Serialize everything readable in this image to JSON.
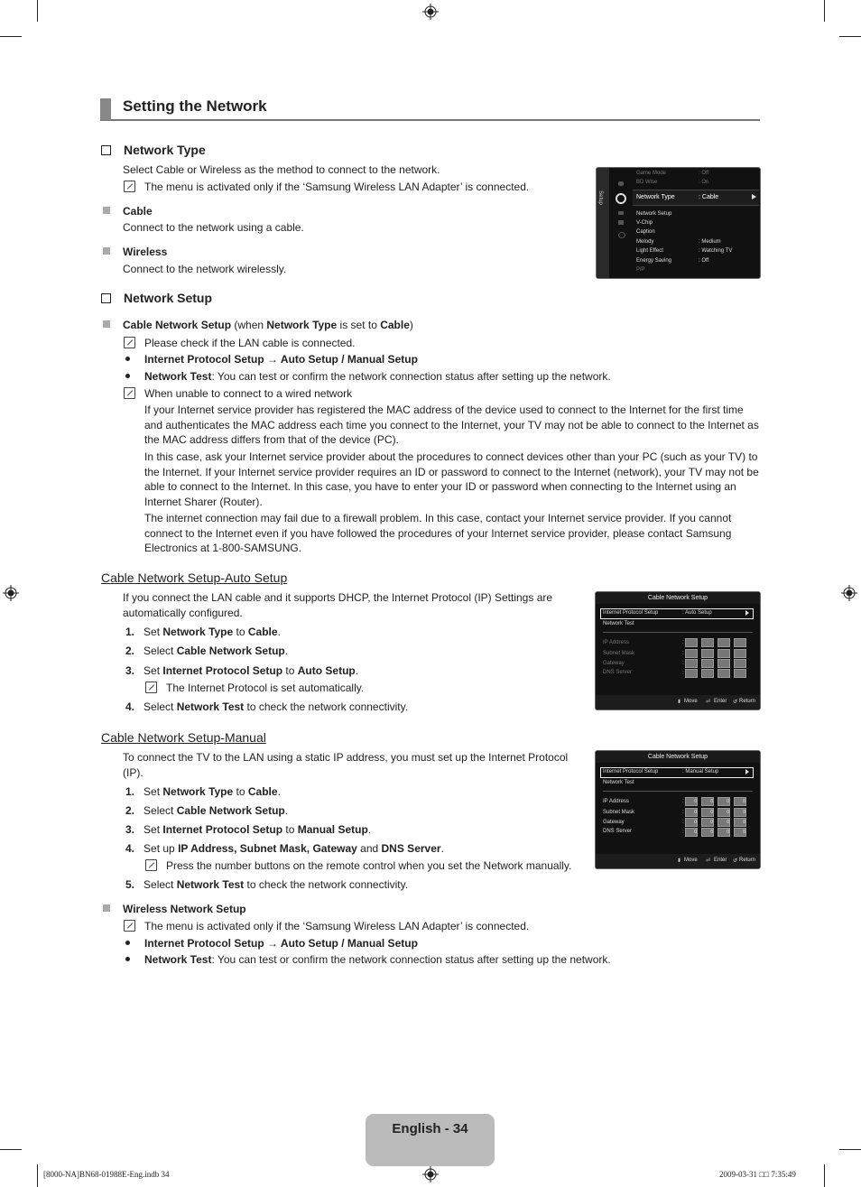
{
  "page": {
    "title": "Setting the Network",
    "page_label": "English - 34",
    "footer_left": "[8000-NA]BN68-01988E-Eng.indb   34",
    "footer_right": "2009-03-31   □□ 7:35:49"
  },
  "network_type": {
    "heading": "Network Type",
    "description": "Select Cable or Wireless as the method to connect to the network.",
    "note": "The menu is activated only if the ‘Samsung Wireless LAN Adapter’ is connected.",
    "options": [
      {
        "label": "Cable",
        "description": "Connect to the network using a cable."
      },
      {
        "label": "Wireless",
        "description": "Connect to the network wirelessly."
      }
    ]
  },
  "network_setup": {
    "heading": "Network Setup",
    "cable_item": {
      "b1": "Cable Network Setup",
      "t1": " (when ",
      "b2": "Network Type",
      "t2": " is set to ",
      "b3": "Cable",
      "t3": ")"
    },
    "note1": "Please check if the LAN cable is connected.",
    "bullet1": "Internet Protocol Setup → Auto Setup / Manual Setup",
    "bullet2_bold": "Network Test",
    "bullet2_text": ": You can test or confirm the network connection status after setting up the network.",
    "note2": "When unable to connect to a wired network",
    "para1": "If your Internet service provider has registered the MAC address of the device used to connect to the Internet for the first time and authenticates the MAC address each time you connect to the Internet, your TV may not be able to connect to the Internet as the MAC address differs from that of the device (PC).",
    "para2": "In this case, ask your Internet service provider about the procedures to connect devices other than your PC (such as your TV) to the Internet. If your Internet service provider requires an ID or password to connect to the Internet (network), your TV may not be able to connect to the Internet. In this case, you have to enter your ID or password when connecting to the Internet using an Internet Sharer (Router).",
    "para3": "The internet connection may fail due to a firewall problem. In this case, contact your Internet service provider. If you cannot connect to the Internet even if you have followed the procedures of your Internet service provider, please contact Samsung Electronics at 1-800-SAMSUNG."
  },
  "auto_setup": {
    "heading": "Cable Network Setup-Auto Setup",
    "intro": "If you connect the LAN cable and it supports DHCP, the Internet Protocol (IP) Settings are automatically configured.",
    "steps": [
      {
        "n": "1.",
        "a": "Set ",
        "b": "Network Type",
        "c": " to ",
        "d": "Cable",
        "e": "."
      },
      {
        "n": "2.",
        "a": "Select ",
        "b": "Cable Network Setup",
        "c": ".",
        "d": "",
        "e": ""
      },
      {
        "n": "3.",
        "a": "Set ",
        "b": "Internet Protocol Setup",
        "c": " to ",
        "d": "Auto Setup",
        "e": "."
      },
      {
        "n": "4.",
        "a": "Select ",
        "b": "Network Test",
        "c": " to check the network connectivity.",
        "d": "",
        "e": ""
      }
    ],
    "note": "The Internet Protocol is set automatically."
  },
  "manual_setup": {
    "heading": "Cable Network Setup-Manual",
    "intro": "To connect the TV to the LAN using a static IP address, you must set up the Internet Protocol (IP).",
    "steps": [
      {
        "n": "1.",
        "a": "Set ",
        "b": "Network Type",
        "c": " to ",
        "d": "Cable",
        "e": "."
      },
      {
        "n": "2.",
        "a": "Select ",
        "b": "Cable Network Setup",
        "c": ".",
        "d": "",
        "e": ""
      },
      {
        "n": "3.",
        "a": "Set ",
        "b": "Internet Protocol Setup",
        "c": " to ",
        "d": "Manual Setup",
        "e": "."
      },
      {
        "n": "4.",
        "a": "Set up ",
        "b": "IP Address, Subnet Mask, Gateway",
        "c": " and ",
        "d": "DNS Server",
        "e": "."
      },
      {
        "n": "5.",
        "a": "Select ",
        "b": "Network Test",
        "c": " to check the network connectivity.",
        "d": "",
        "e": ""
      }
    ],
    "note": "Press the number buttons on the remote control when you set the Network manually."
  },
  "wireless_setup": {
    "heading": "Wireless Network Setup",
    "note": "The menu is activated only if the ‘Samsung Wireless LAN Adapter’ is connected.",
    "bullet1": "Internet Protocol Setup → Auto Setup / Manual Setup",
    "bullet2_bold": "Network Test",
    "bullet2_text": ": You can test or confirm the network connection status after setting up the network."
  },
  "screen1": {
    "side_label": "Setup",
    "items": [
      {
        "label": "Game Mode",
        "value": ": Off",
        "dim": true
      },
      {
        "label": "BD Wise",
        "value": ": On",
        "dim": true
      },
      {
        "label": "Network Type",
        "value": ": Cable",
        "selected": true
      },
      {
        "label": "Network Setup",
        "value": ""
      },
      {
        "label": "V-Chip",
        "value": ""
      },
      {
        "label": "Caption",
        "value": ""
      },
      {
        "label": "Melody",
        "value": ": Medium"
      },
      {
        "label": "Light Effect",
        "value": ": Watching TV"
      },
      {
        "label": "Energy Saving",
        "value": ": Off"
      },
      {
        "label": "PIP",
        "value": "",
        "dim": true
      }
    ]
  },
  "screen2": {
    "title": "Cable Network Setup",
    "protocol_label": "Internet Protocol Setup",
    "protocol_value": ": Auto Setup",
    "test_label": "Network Test",
    "fields": [
      "IP Address",
      "Subnet Mask",
      "Gateway",
      "DNS Server"
    ],
    "footer": {
      "move": "Move",
      "enter": "Enter",
      "return": "Return"
    }
  },
  "screen3": {
    "title": "Cable Network Setup",
    "protocol_label": "Internet Protocol Setup",
    "protocol_value": ": Manual Setup",
    "test_label": "Network Test",
    "fields": [
      "IP Address",
      "Subnet Mask",
      "Gateway",
      "DNS Server"
    ],
    "cell_value": "0",
    "footer": {
      "move": "Move",
      "enter": "Enter",
      "return": "Return"
    }
  }
}
